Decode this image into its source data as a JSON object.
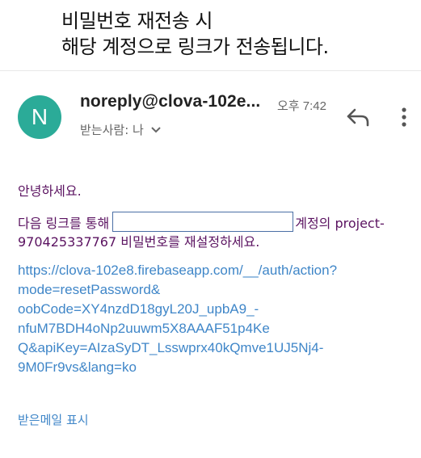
{
  "caption": {
    "line1": "비밀번호 재전송 시",
    "line2": "해당 계정으로 링크가 전송됩니다."
  },
  "email": {
    "avatar_letter": "N",
    "sender": "noreply@clova-102e...",
    "time": "오후 7:42",
    "recipient_label": "받는사람: 나",
    "greeting": "안녕하세요.",
    "instruction_prefix": "다음 링크를 통해",
    "instruction_suffix": "계정의 project-",
    "instruction_line2": "970425337767 비밀번호를 재설정하세요.",
    "reset_link_lines": [
      "https://clova-102e8.firebaseapp.com/__/auth/action?",
      "mode=resetPassword&",
      "oobCode=XY4nzdD18gyL20J_upbA9_-",
      "nfuM7BDH4oNp2uuwm5X8AAAF51p4Ke",
      "Q&apiKey=AIzaSyDT_Lsswprx40kQmve1UJ5Nj4-",
      "9M0Fr9vs&lang=ko"
    ],
    "show_quoted": "받은메일 표시"
  },
  "icons": {
    "reply": "reply-icon",
    "more": "more-vert-icon",
    "chevron": "chevron-down-icon"
  },
  "colors": {
    "avatar": "#2bab98",
    "body_text": "#5a1260",
    "link": "#3f86c8"
  }
}
